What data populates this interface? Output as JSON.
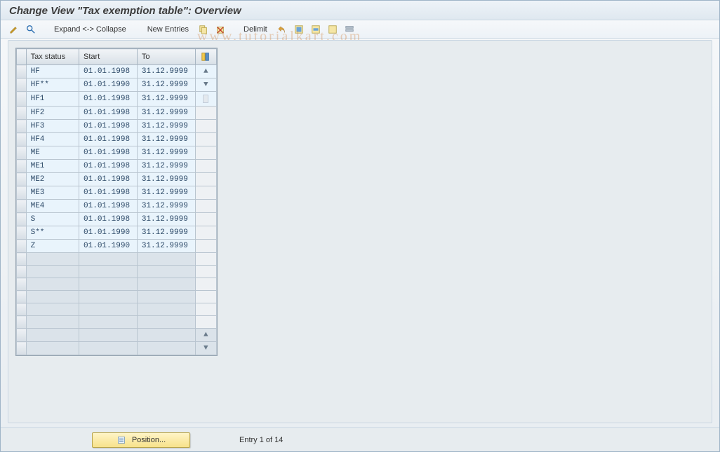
{
  "title": "Change View \"Tax exemption table\": Overview",
  "toolbar": {
    "expand_collapse_label": "Expand <-> Collapse",
    "new_entries_label": "New Entries",
    "delimit_label": "Delimit"
  },
  "table": {
    "columns": {
      "tax_status": "Tax status",
      "start": "Start",
      "to": "To"
    },
    "rows": [
      {
        "tax_status": "HF",
        "start": "01.01.1998",
        "to": "31.12.9999"
      },
      {
        "tax_status": "HF**",
        "start": "01.01.1990",
        "to": "31.12.9999"
      },
      {
        "tax_status": "HF1",
        "start": "01.01.1998",
        "to": "31.12.9999"
      },
      {
        "tax_status": "HF2",
        "start": "01.01.1998",
        "to": "31.12.9999"
      },
      {
        "tax_status": "HF3",
        "start": "01.01.1998",
        "to": "31.12.9999"
      },
      {
        "tax_status": "HF4",
        "start": "01.01.1998",
        "to": "31.12.9999"
      },
      {
        "tax_status": "ME",
        "start": "01.01.1998",
        "to": "31.12.9999"
      },
      {
        "tax_status": "ME1",
        "start": "01.01.1998",
        "to": "31.12.9999"
      },
      {
        "tax_status": "ME2",
        "start": "01.01.1998",
        "to": "31.12.9999"
      },
      {
        "tax_status": "ME3",
        "start": "01.01.1998",
        "to": "31.12.9999"
      },
      {
        "tax_status": "ME4",
        "start": "01.01.1998",
        "to": "31.12.9999"
      },
      {
        "tax_status": "S",
        "start": "01.01.1998",
        "to": "31.12.9999"
      },
      {
        "tax_status": "S**",
        "start": "01.01.1990",
        "to": "31.12.9999"
      },
      {
        "tax_status": "Z",
        "start": "01.01.1990",
        "to": "31.12.9999"
      }
    ],
    "empty_visible_rows": 8
  },
  "footer": {
    "position_button_label": "Position...",
    "entry_status": "Entry 1 of 14"
  },
  "watermark": "www.tutorialkart.com",
  "colors": {
    "accent_yellow": "#f7e28a",
    "cell_blue": "#e9f4fc"
  }
}
